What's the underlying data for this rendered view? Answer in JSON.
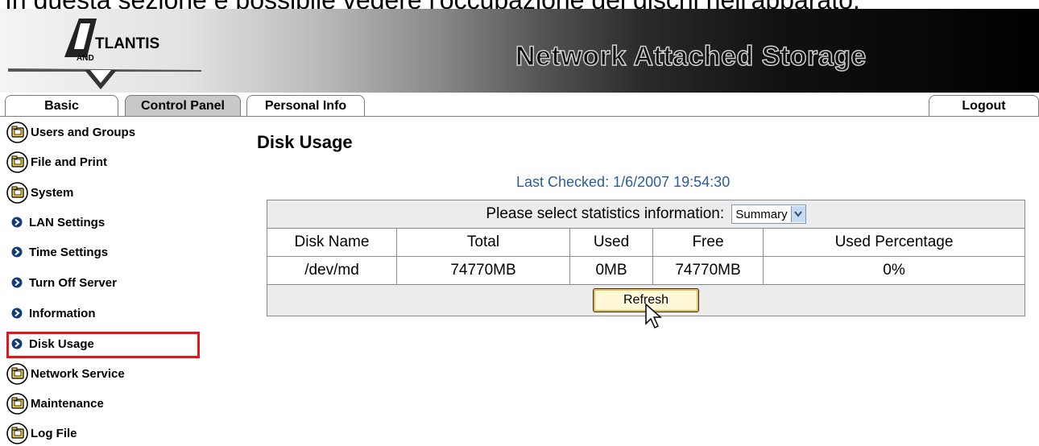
{
  "caption": "In questa sezione è possibile vedere l'occupazione dei dischi nell'apparato.",
  "banner": {
    "logo_text_main": "TLANTIS",
    "logo_text_sub": "AND",
    "title": "Network Attached Storage"
  },
  "tabs": [
    {
      "label": "Basic",
      "active": false
    },
    {
      "label": "Control Panel",
      "active": true
    },
    {
      "label": "Personal Info",
      "active": false
    }
  ],
  "logout_label": "Logout",
  "sidebar": {
    "items": [
      {
        "label": "Users and Groups",
        "icon": "folder-icon"
      },
      {
        "label": "File and Print",
        "icon": "folder-icon"
      },
      {
        "label": "System",
        "icon": "folder-icon"
      },
      {
        "label": "LAN Settings",
        "icon": "bullet-icon"
      },
      {
        "label": "Time Settings",
        "icon": "bullet-icon"
      },
      {
        "label": "Turn Off Server",
        "icon": "bullet-icon"
      },
      {
        "label": "Information",
        "icon": "bullet-icon"
      },
      {
        "label": "Disk Usage",
        "icon": "bullet-icon",
        "highlighted": true
      },
      {
        "label": "Network Service",
        "icon": "folder-icon"
      },
      {
        "label": "Maintenance",
        "icon": "folder-icon"
      },
      {
        "label": "Log File",
        "icon": "folder-icon"
      }
    ]
  },
  "main": {
    "title": "Disk Usage",
    "last_checked": "Last Checked: 1/6/2007 19:54:30",
    "select_prompt": "Please select statistics information:",
    "select_value": "Summary",
    "columns": [
      "Disk Name",
      "Total",
      "Used",
      "Free",
      "Used Percentage"
    ],
    "rows": [
      [
        "/dev/md",
        "74770MB",
        "0MB",
        "74770MB",
        "0%"
      ]
    ],
    "refresh_label": "Refresh"
  },
  "colors": {
    "highlight": "#e5161b",
    "link_blue": "#2a5e9b"
  }
}
